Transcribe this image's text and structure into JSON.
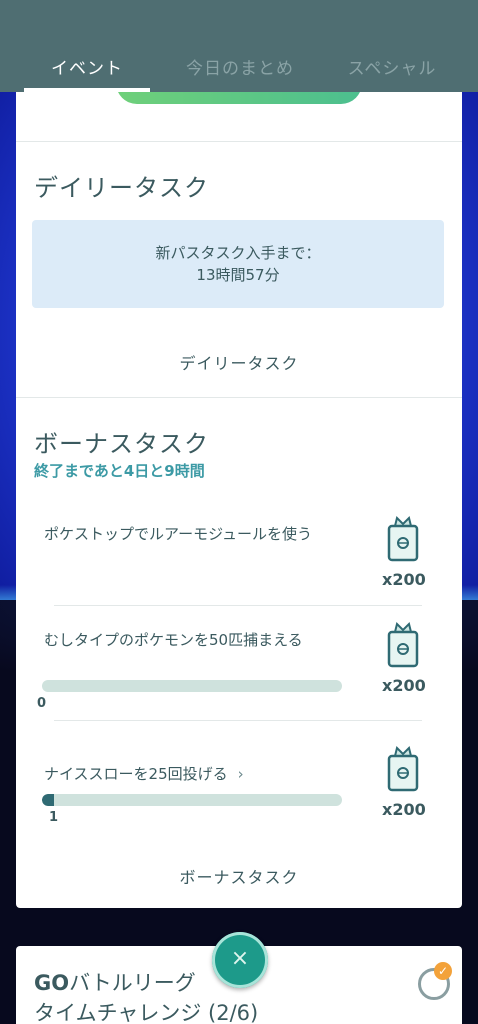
{
  "tabs": [
    {
      "label": "イベント",
      "active": true
    },
    {
      "label": "今日のまとめ",
      "active": false
    },
    {
      "label": "スペシャル",
      "active": false
    }
  ],
  "daily": {
    "title": "デイリータスク",
    "info_line1": "新パスタスク入手まで：",
    "info_line2": "13時間57分",
    "footer": "デイリータスク"
  },
  "bonus": {
    "title": "ボーナスタスク",
    "subtitle": "終了まであと4日と9時間",
    "footer": "ボーナスタスク",
    "tasks": [
      {
        "text": "ポケストップでルアーモジュールを使う",
        "reward": "x200"
      },
      {
        "text": "むしタイプのポケモンを50匹捕まえる",
        "reward": "x200",
        "progress": 0,
        "progress_label": "0",
        "progress_fraction": 0.0
      },
      {
        "text": "ナイススローを25回投げる",
        "chevron": "›",
        "reward": "x200",
        "progress": 1,
        "progress_label": "1",
        "progress_fraction": 0.04
      }
    ]
  },
  "go": {
    "title_line1_bold": "GO",
    "title_line1_rest": "バトルリーグ",
    "title_line2": "タイムチャレンジ (2/6)",
    "badge_check": "✓"
  },
  "close_button": {
    "glyph": "×"
  },
  "colors": {
    "topbar": "#4f6e72",
    "accent_teal": "#3c9aa5",
    "text": "#3b5a5f",
    "info_box": "#dcebf8",
    "progress_track": "#cfe2dd",
    "progress_fill": "#2f6a73"
  },
  "icons": [
    "reward-pass-icon",
    "close-icon",
    "chevron-right-icon",
    "badge-check-icon"
  ]
}
